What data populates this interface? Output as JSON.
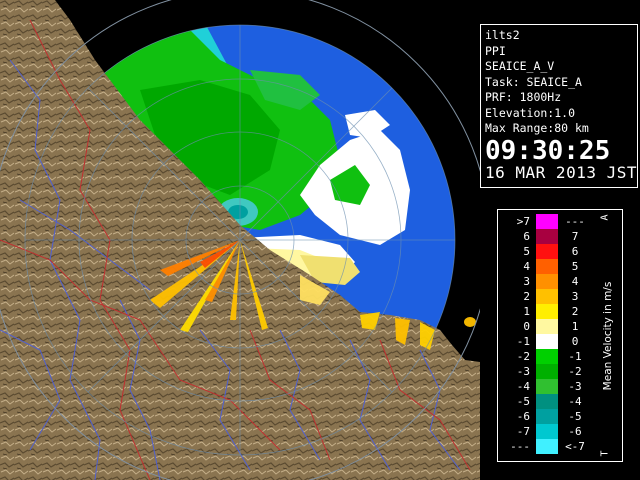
{
  "header": {
    "station": "ilts2",
    "product": "PPI",
    "field": "SEAICE_A_V",
    "task": "Task: SEAICE_A",
    "prf": "PRF: 1800Hz",
    "elevation": "Elevation:1.0",
    "max_range": "Max Range:80 km",
    "time": "09:30:25",
    "date": "16 MAR 2013 JST"
  },
  "legend": {
    "title": "Mean Velocity in m/s",
    "corner_top": "A",
    "corner_bottom": "T",
    "rows": [
      {
        "left": ">7",
        "right": "---",
        "color": "#ff00ff"
      },
      {
        "left": "6",
        "right": "7",
        "color": "#a80040"
      },
      {
        "left": "5",
        "right": "6",
        "color": "#ff1010"
      },
      {
        "left": "4",
        "right": "5",
        "color": "#ff6000"
      },
      {
        "left": "3",
        "right": "4",
        "color": "#ff9000"
      },
      {
        "left": "2",
        "right": "3",
        "color": "#ffc000"
      },
      {
        "left": "1",
        "right": "2",
        "color": "#ffee00"
      },
      {
        "left": "0",
        "right": "1",
        "color": "#fff8a0"
      },
      {
        "left": "-1",
        "right": "0",
        "color": "#ffffff"
      },
      {
        "left": "-2",
        "right": "-1",
        "color": "#00d000"
      },
      {
        "left": "-3",
        "right": "-2",
        "color": "#00b000"
      },
      {
        "left": "-4",
        "right": "-3",
        "color": "#30c030"
      },
      {
        "left": "-5",
        "right": "-4",
        "color": "#009080"
      },
      {
        "left": "-6",
        "right": "-5",
        "color": "#00a0a0"
      },
      {
        "left": "-7",
        "right": "-6",
        "color": "#00c8d0"
      },
      {
        "left": "---",
        "right": "<-7",
        "color": "#40f0ff"
      }
    ]
  },
  "map": {
    "sea_color": "#1e5fe0",
    "land_color": "#8a7450",
    "river_color": "#5060d0",
    "boundary_color": "#c03030"
  }
}
